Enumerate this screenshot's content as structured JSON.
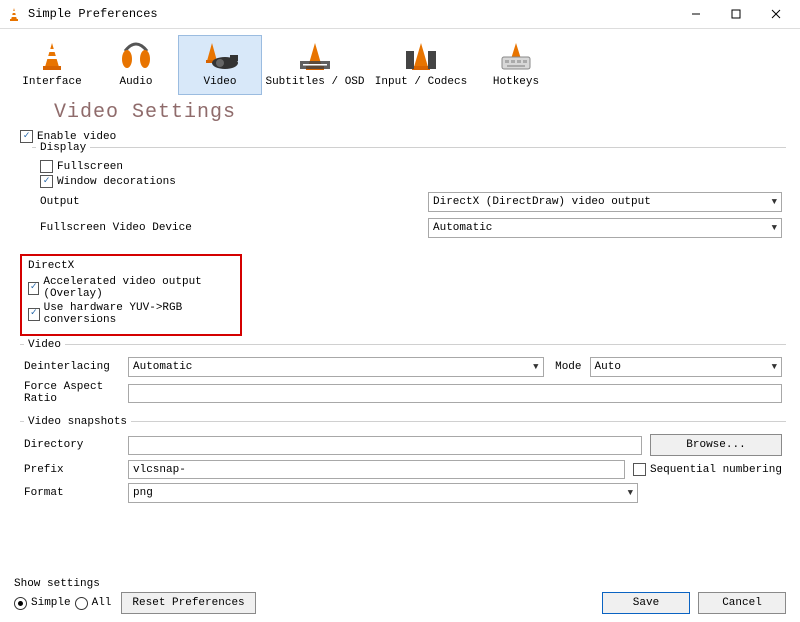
{
  "window": {
    "title": "Simple Preferences"
  },
  "toolbar": {
    "items": [
      {
        "label": "Interface"
      },
      {
        "label": "Audio"
      },
      {
        "label": "Video",
        "selected": true
      },
      {
        "label": "Subtitles / OSD"
      },
      {
        "label": "Input / Codecs"
      },
      {
        "label": "Hotkeys"
      }
    ]
  },
  "page": {
    "title": "Video Settings",
    "enable_video": "Enable video",
    "groups": {
      "display": {
        "label": "Display",
        "fullscreen": "Fullscreen",
        "window_decorations": "Window decorations",
        "output_label": "Output",
        "output_value": "DirectX (DirectDraw) video output",
        "device_label": "Fullscreen Video Device",
        "device_value": "Automatic"
      },
      "directx": {
        "label": "DirectX",
        "accel": "Accelerated video output (Overlay)",
        "yuv": "Use hardware YUV->RGB conversions"
      },
      "video": {
        "label": "Video",
        "deint_label": "Deinterlacing",
        "deint_value": "Automatic",
        "mode_label": "Mode",
        "mode_value": "Auto",
        "force_ar_label": "Force Aspect Ratio",
        "force_ar_value": ""
      },
      "snapshots": {
        "label": "Video snapshots",
        "dir_label": "Directory",
        "dir_value": "",
        "browse": "Browse...",
        "prefix_label": "Prefix",
        "prefix_value": "vlcsnap-",
        "seq": "Sequential numbering",
        "format_label": "Format",
        "format_value": "png"
      }
    }
  },
  "footer": {
    "show_settings": "Show settings",
    "simple": "Simple",
    "all": "All",
    "reset": "Reset Preferences",
    "save": "Save",
    "cancel": "Cancel"
  }
}
